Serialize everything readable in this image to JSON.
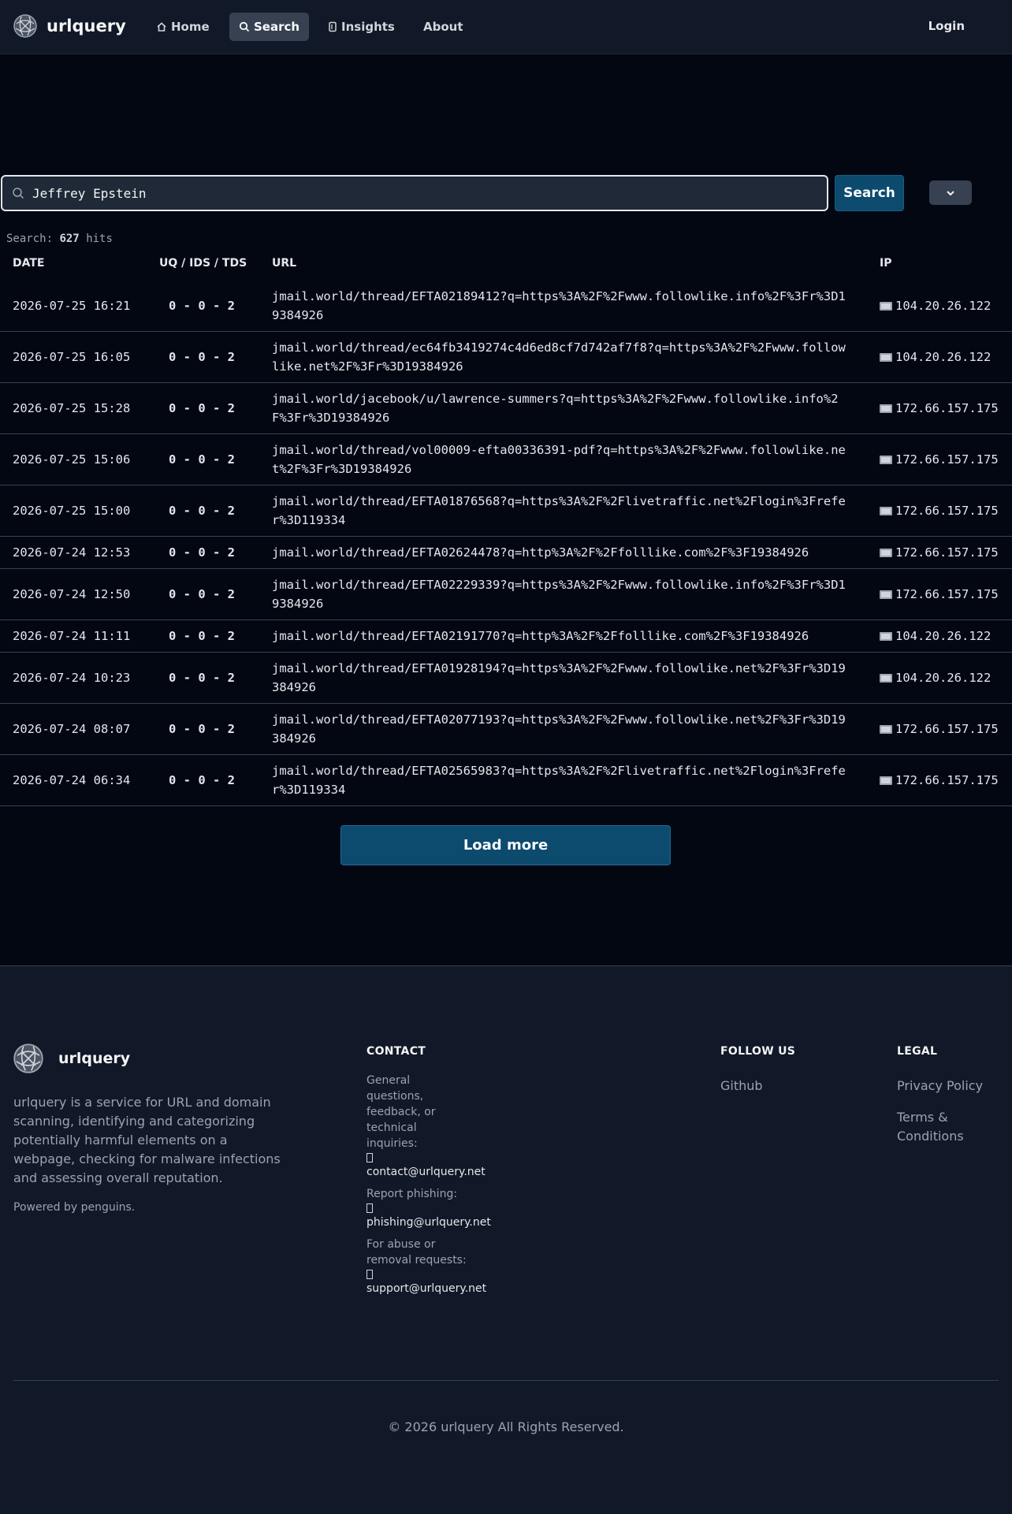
{
  "nav": {
    "brand": "urlquery",
    "links": [
      {
        "label": "Home",
        "icon": "home-icon"
      },
      {
        "label": "Search",
        "icon": "search-icon"
      },
      {
        "label": "Insights",
        "icon": "insights-icon"
      },
      {
        "label": "About",
        "icon": ""
      }
    ],
    "login": "Login"
  },
  "search": {
    "value": "Jeffrey Epstein",
    "button": "Search",
    "hits_prefix": "Search:",
    "hits_count": "627",
    "hits_suffix": "hits"
  },
  "table": {
    "headers": [
      "DATE",
      "UQ / IDS / TDS",
      "URL",
      "IP"
    ],
    "rows": [
      {
        "date": "2026-07-25 16:21",
        "score": "0 - 0 - 2",
        "url": "jmail.world/thread/EFTA02189412?q=https%3A%2F%2Fwww.followlike.info%2F%3Fr%3D19384926",
        "ip": "104.20.26.122"
      },
      {
        "date": "2026-07-25 16:05",
        "score": "0 - 0 - 2",
        "url": "jmail.world/thread/ec64fb3419274c4d6ed8cf7d742af7f8?q=https%3A%2F%2Fwww.followlike.net%2F%3Fr%3D19384926",
        "ip": "104.20.26.122"
      },
      {
        "date": "2026-07-25 15:28",
        "score": "0 - 0 - 2",
        "url": "jmail.world/jacebook/u/lawrence-summers?q=https%3A%2F%2Fwww.followlike.info%2F%3Fr%3D19384926",
        "ip": "172.66.157.175"
      },
      {
        "date": "2026-07-25 15:06",
        "score": "0 - 0 - 2",
        "url": "jmail.world/thread/vol00009-efta00336391-pdf?q=https%3A%2F%2Fwww.followlike.net%2F%3Fr%3D19384926",
        "ip": "172.66.157.175"
      },
      {
        "date": "2026-07-25 15:00",
        "score": "0 - 0 - 2",
        "url": "jmail.world/thread/EFTA01876568?q=https%3A%2F%2Flivetraffic.net%2Flogin%3Frefer%3D119334",
        "ip": "172.66.157.175"
      },
      {
        "date": "2026-07-24 12:53",
        "score": "0 - 0 - 2",
        "url": "jmail.world/thread/EFTA02624478?q=http%3A%2F%2Ffolllike.com%2F%3F19384926",
        "ip": "172.66.157.175"
      },
      {
        "date": "2026-07-24 12:50",
        "score": "0 - 0 - 2",
        "url": "jmail.world/thread/EFTA02229339?q=https%3A%2F%2Fwww.followlike.info%2F%3Fr%3D19384926",
        "ip": "172.66.157.175"
      },
      {
        "date": "2026-07-24 11:11",
        "score": "0 - 0 - 2",
        "url": "jmail.world/thread/EFTA02191770?q=http%3A%2F%2Ffolllike.com%2F%3F19384926",
        "ip": "104.20.26.122"
      },
      {
        "date": "2026-07-24 10:23",
        "score": "0 - 0 - 2",
        "url": "jmail.world/thread/EFTA01928194?q=https%3A%2F%2Fwww.followlike.net%2F%3Fr%3D19384926",
        "ip": "104.20.26.122"
      },
      {
        "date": "2026-07-24 08:07",
        "score": "0 - 0 - 2",
        "url": "jmail.world/thread/EFTA02077193?q=https%3A%2F%2Fwww.followlike.net%2F%3Fr%3D19384926",
        "ip": "172.66.157.175"
      },
      {
        "date": "2026-07-24 06:34",
        "score": "0 - 0 - 2",
        "url": "jmail.world/thread/EFTA02565983?q=https%3A%2F%2Flivetraffic.net%2Flogin%3Frefer%3D119334",
        "ip": "172.66.157.175"
      }
    ]
  },
  "load_more": "Load more",
  "footer": {
    "brand": "urlquery",
    "description": "urlquery is a service for URL and domain scanning, identifying and categorizing potentially harmful elements on a webpage, checking for malware infections and assessing overall reputation.",
    "powered": "Powered by penguins.",
    "contact_heading": "CONTACT",
    "contact": [
      {
        "label": "General questions, feedback, or technical inquiries:",
        "email": "contact@urlquery.net"
      },
      {
        "label": "Report phishing:",
        "email": "phishing@urlquery.net"
      },
      {
        "label": "For abuse or removal requests:",
        "email": "support@urlquery.net"
      }
    ],
    "follow_heading": "FOLLOW US",
    "follow_links": [
      "Github"
    ],
    "legal_heading": "LEGAL",
    "legal_links": [
      "Privacy Policy",
      "Terms & Conditions"
    ],
    "copyright": "© 2026 urlquery All Rights Reserved."
  },
  "colors": {
    "background": "#030712",
    "panel": "#111827",
    "accent": "#0c4a6e"
  }
}
